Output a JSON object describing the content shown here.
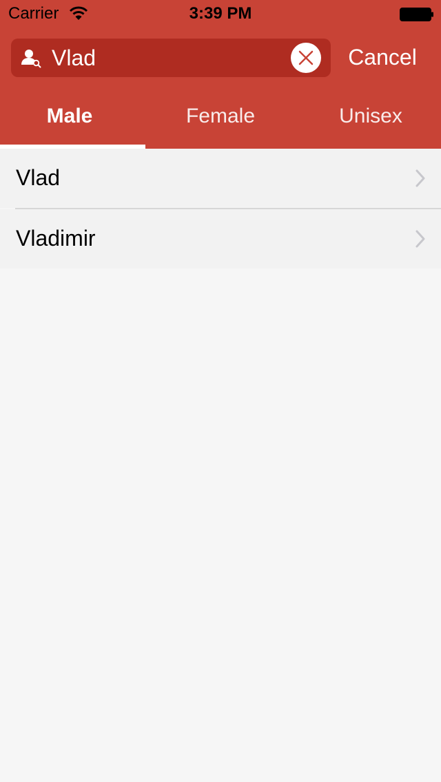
{
  "status_bar": {
    "carrier": "Carrier",
    "time": "3:39 PM",
    "wifi_icon": "wifi-icon",
    "battery_icon": "battery-icon"
  },
  "search": {
    "value": "Vlad",
    "person_icon": "person-search-icon",
    "clear_icon": "clear-icon",
    "cancel_label": "Cancel"
  },
  "tabs": [
    {
      "label": "Male",
      "active": true
    },
    {
      "label": "Female",
      "active": false
    },
    {
      "label": "Unisex",
      "active": false
    }
  ],
  "results": [
    {
      "label": "Vlad"
    },
    {
      "label": "Vladimir"
    }
  ],
  "colors": {
    "accent": "#c84336",
    "search_field": "#af2c21",
    "background": "#f6f6f6"
  }
}
